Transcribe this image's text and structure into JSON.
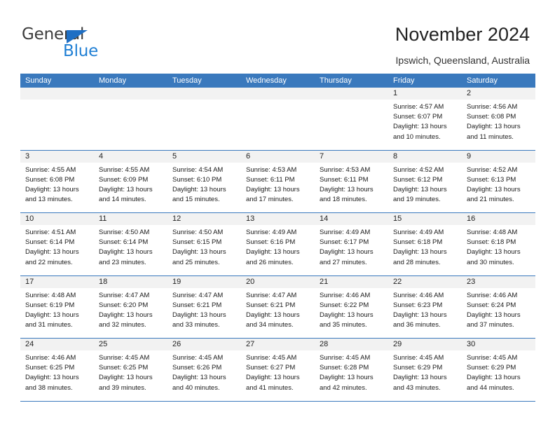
{
  "brand": {
    "name_top": "General",
    "name_bottom": "Blue",
    "triangle_color": "#1f6fc4",
    "blue_color": "#1f7fd4"
  },
  "header": {
    "title": "November 2024",
    "subtitle": "Ipswich, Queensland, Australia",
    "header_bg": "#3a79bd",
    "day_head_bg": "#f2f2f2"
  },
  "weekdays": [
    "Sunday",
    "Monday",
    "Tuesday",
    "Wednesday",
    "Thursday",
    "Friday",
    "Saturday"
  ],
  "labels": {
    "sunrise_prefix": "Sunrise:",
    "sunset_prefix": "Sunset:",
    "daylight_prefix": "Daylight:"
  },
  "weeks": [
    [
      {
        "day": "",
        "empty": true,
        "l1": "",
        "l2": "",
        "l3": "",
        "l4": ""
      },
      {
        "day": "",
        "empty": true,
        "l1": "",
        "l2": "",
        "l3": "",
        "l4": ""
      },
      {
        "day": "",
        "empty": true,
        "l1": "",
        "l2": "",
        "l3": "",
        "l4": ""
      },
      {
        "day": "",
        "empty": true,
        "l1": "",
        "l2": "",
        "l3": "",
        "l4": ""
      },
      {
        "day": "",
        "empty": true,
        "l1": "",
        "l2": "",
        "l3": "",
        "l4": ""
      },
      {
        "day": "1",
        "empty": false,
        "l1": "Sunrise: 4:57 AM",
        "l2": "Sunset: 6:07 PM",
        "l3": "Daylight: 13 hours",
        "l4": "and 10 minutes."
      },
      {
        "day": "2",
        "empty": false,
        "l1": "Sunrise: 4:56 AM",
        "l2": "Sunset: 6:08 PM",
        "l3": "Daylight: 13 hours",
        "l4": "and 11 minutes."
      }
    ],
    [
      {
        "day": "3",
        "empty": false,
        "l1": "Sunrise: 4:55 AM",
        "l2": "Sunset: 6:08 PM",
        "l3": "Daylight: 13 hours",
        "l4": "and 13 minutes."
      },
      {
        "day": "4",
        "empty": false,
        "l1": "Sunrise: 4:55 AM",
        "l2": "Sunset: 6:09 PM",
        "l3": "Daylight: 13 hours",
        "l4": "and 14 minutes."
      },
      {
        "day": "5",
        "empty": false,
        "l1": "Sunrise: 4:54 AM",
        "l2": "Sunset: 6:10 PM",
        "l3": "Daylight: 13 hours",
        "l4": "and 15 minutes."
      },
      {
        "day": "6",
        "empty": false,
        "l1": "Sunrise: 4:53 AM",
        "l2": "Sunset: 6:11 PM",
        "l3": "Daylight: 13 hours",
        "l4": "and 17 minutes."
      },
      {
        "day": "7",
        "empty": false,
        "l1": "Sunrise: 4:53 AM",
        "l2": "Sunset: 6:11 PM",
        "l3": "Daylight: 13 hours",
        "l4": "and 18 minutes."
      },
      {
        "day": "8",
        "empty": false,
        "l1": "Sunrise: 4:52 AM",
        "l2": "Sunset: 6:12 PM",
        "l3": "Daylight: 13 hours",
        "l4": "and 19 minutes."
      },
      {
        "day": "9",
        "empty": false,
        "l1": "Sunrise: 4:52 AM",
        "l2": "Sunset: 6:13 PM",
        "l3": "Daylight: 13 hours",
        "l4": "and 21 minutes."
      }
    ],
    [
      {
        "day": "10",
        "empty": false,
        "l1": "Sunrise: 4:51 AM",
        "l2": "Sunset: 6:14 PM",
        "l3": "Daylight: 13 hours",
        "l4": "and 22 minutes."
      },
      {
        "day": "11",
        "empty": false,
        "l1": "Sunrise: 4:50 AM",
        "l2": "Sunset: 6:14 PM",
        "l3": "Daylight: 13 hours",
        "l4": "and 23 minutes."
      },
      {
        "day": "12",
        "empty": false,
        "l1": "Sunrise: 4:50 AM",
        "l2": "Sunset: 6:15 PM",
        "l3": "Daylight: 13 hours",
        "l4": "and 25 minutes."
      },
      {
        "day": "13",
        "empty": false,
        "l1": "Sunrise: 4:49 AM",
        "l2": "Sunset: 6:16 PM",
        "l3": "Daylight: 13 hours",
        "l4": "and 26 minutes."
      },
      {
        "day": "14",
        "empty": false,
        "l1": "Sunrise: 4:49 AM",
        "l2": "Sunset: 6:17 PM",
        "l3": "Daylight: 13 hours",
        "l4": "and 27 minutes."
      },
      {
        "day": "15",
        "empty": false,
        "l1": "Sunrise: 4:49 AM",
        "l2": "Sunset: 6:18 PM",
        "l3": "Daylight: 13 hours",
        "l4": "and 28 minutes."
      },
      {
        "day": "16",
        "empty": false,
        "l1": "Sunrise: 4:48 AM",
        "l2": "Sunset: 6:18 PM",
        "l3": "Daylight: 13 hours",
        "l4": "and 30 minutes."
      }
    ],
    [
      {
        "day": "17",
        "empty": false,
        "l1": "Sunrise: 4:48 AM",
        "l2": "Sunset: 6:19 PM",
        "l3": "Daylight: 13 hours",
        "l4": "and 31 minutes."
      },
      {
        "day": "18",
        "empty": false,
        "l1": "Sunrise: 4:47 AM",
        "l2": "Sunset: 6:20 PM",
        "l3": "Daylight: 13 hours",
        "l4": "and 32 minutes."
      },
      {
        "day": "19",
        "empty": false,
        "l1": "Sunrise: 4:47 AM",
        "l2": "Sunset: 6:21 PM",
        "l3": "Daylight: 13 hours",
        "l4": "and 33 minutes."
      },
      {
        "day": "20",
        "empty": false,
        "l1": "Sunrise: 4:47 AM",
        "l2": "Sunset: 6:21 PM",
        "l3": "Daylight: 13 hours",
        "l4": "and 34 minutes."
      },
      {
        "day": "21",
        "empty": false,
        "l1": "Sunrise: 4:46 AM",
        "l2": "Sunset: 6:22 PM",
        "l3": "Daylight: 13 hours",
        "l4": "and 35 minutes."
      },
      {
        "day": "22",
        "empty": false,
        "l1": "Sunrise: 4:46 AM",
        "l2": "Sunset: 6:23 PM",
        "l3": "Daylight: 13 hours",
        "l4": "and 36 minutes."
      },
      {
        "day": "23",
        "empty": false,
        "l1": "Sunrise: 4:46 AM",
        "l2": "Sunset: 6:24 PM",
        "l3": "Daylight: 13 hours",
        "l4": "and 37 minutes."
      }
    ],
    [
      {
        "day": "24",
        "empty": false,
        "l1": "Sunrise: 4:46 AM",
        "l2": "Sunset: 6:25 PM",
        "l3": "Daylight: 13 hours",
        "l4": "and 38 minutes."
      },
      {
        "day": "25",
        "empty": false,
        "l1": "Sunrise: 4:45 AM",
        "l2": "Sunset: 6:25 PM",
        "l3": "Daylight: 13 hours",
        "l4": "and 39 minutes."
      },
      {
        "day": "26",
        "empty": false,
        "l1": "Sunrise: 4:45 AM",
        "l2": "Sunset: 6:26 PM",
        "l3": "Daylight: 13 hours",
        "l4": "and 40 minutes."
      },
      {
        "day": "27",
        "empty": false,
        "l1": "Sunrise: 4:45 AM",
        "l2": "Sunset: 6:27 PM",
        "l3": "Daylight: 13 hours",
        "l4": "and 41 minutes."
      },
      {
        "day": "28",
        "empty": false,
        "l1": "Sunrise: 4:45 AM",
        "l2": "Sunset: 6:28 PM",
        "l3": "Daylight: 13 hours",
        "l4": "and 42 minutes."
      },
      {
        "day": "29",
        "empty": false,
        "l1": "Sunrise: 4:45 AM",
        "l2": "Sunset: 6:29 PM",
        "l3": "Daylight: 13 hours",
        "l4": "and 43 minutes."
      },
      {
        "day": "30",
        "empty": false,
        "l1": "Sunrise: 4:45 AM",
        "l2": "Sunset: 6:29 PM",
        "l3": "Daylight: 13 hours",
        "l4": "and 44 minutes."
      }
    ]
  ]
}
